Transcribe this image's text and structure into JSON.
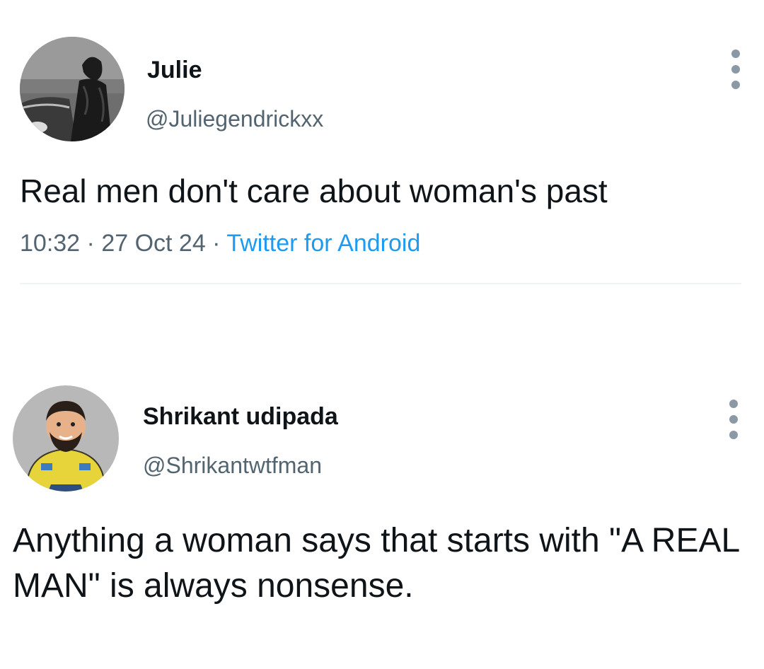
{
  "tweets": [
    {
      "display_name": "Julie",
      "handle": "@Juliegendrickxx",
      "text": "Real men don't care about woman's past",
      "time": "10:32",
      "date": "27 Oct 24",
      "separator": " · ",
      "source": "Twitter for Android",
      "more_icon": "more-vertical-icon"
    },
    {
      "display_name": "Shrikant udipada",
      "handle": "@Shrikantwtfman",
      "text": "Anything a woman says that starts with \"A REAL MAN\" is always nonsense.",
      "more_icon": "more-vertical-icon"
    }
  ],
  "colors": {
    "text_primary": "#0f1419",
    "text_secondary": "#536471",
    "link": "#1d9bf0",
    "divider": "#eff3f4",
    "more_dots": "#8b98a5"
  }
}
